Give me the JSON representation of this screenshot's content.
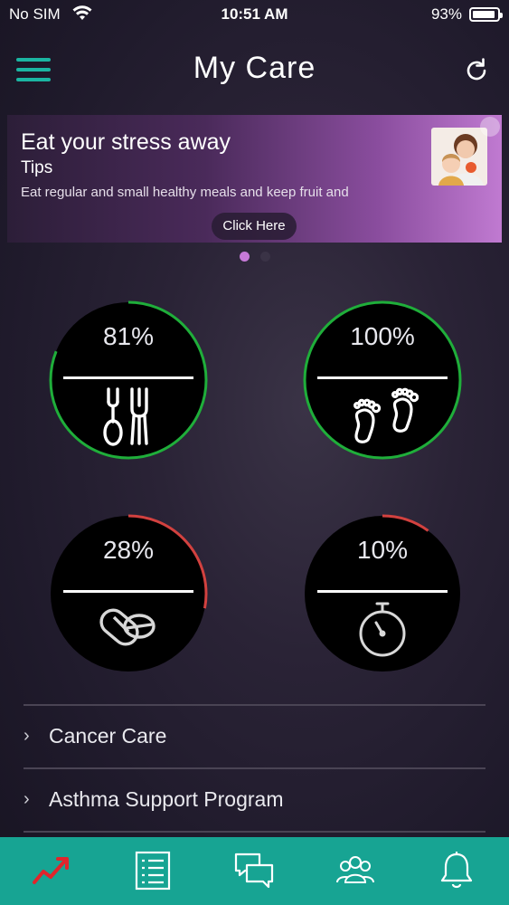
{
  "status_bar": {
    "carrier": "No SIM",
    "time": "10:51 AM",
    "battery": "93%",
    "battery_level": 0.93
  },
  "header": {
    "logo": "My Care",
    "menu_icon": "hamburger-menu-icon",
    "refresh_icon": "refresh-icon"
  },
  "banner": {
    "title": "Eat your stress away",
    "subtitle": "Tips",
    "body": "Eat regular and small healthy meals and keep fruit and",
    "cta": "Click Here",
    "pages": 2,
    "active_page": 1
  },
  "tiles": [
    {
      "id": "diet",
      "percent_label": "81%",
      "value": 0.81,
      "icon": "fork-spoon-icon",
      "status_color": "#1fae3a"
    },
    {
      "id": "steps",
      "percent_label": "100%",
      "value": 1.0,
      "icon": "footprints-icon",
      "status_color": "#1fae3a"
    },
    {
      "id": "medication",
      "percent_label": "28%",
      "value": 0.28,
      "icon": "pills-icon",
      "status_color": "#d2413f"
    },
    {
      "id": "activity",
      "percent_label": "10%",
      "value": 0.1,
      "icon": "stopwatch-icon",
      "status_color": "#d2413f"
    }
  ],
  "programs": [
    {
      "label": "Cancer Care"
    },
    {
      "label": "Asthma Support Program"
    }
  ],
  "tabbar": {
    "items": [
      {
        "name": "trends",
        "icon": "trend-chart-icon",
        "active": true
      },
      {
        "name": "records",
        "icon": "list-document-icon",
        "active": false
      },
      {
        "name": "messages",
        "icon": "chat-bubbles-icon",
        "active": false
      },
      {
        "name": "community",
        "icon": "people-group-icon",
        "active": false
      },
      {
        "name": "notifications",
        "icon": "bell-icon",
        "active": false
      }
    ]
  },
  "colors": {
    "accent": "#1bb5a2",
    "tabbar": "#17a493",
    "good": "#1fae3a",
    "warning": "#d2413f",
    "active_tab_icon": "#e0252c"
  }
}
